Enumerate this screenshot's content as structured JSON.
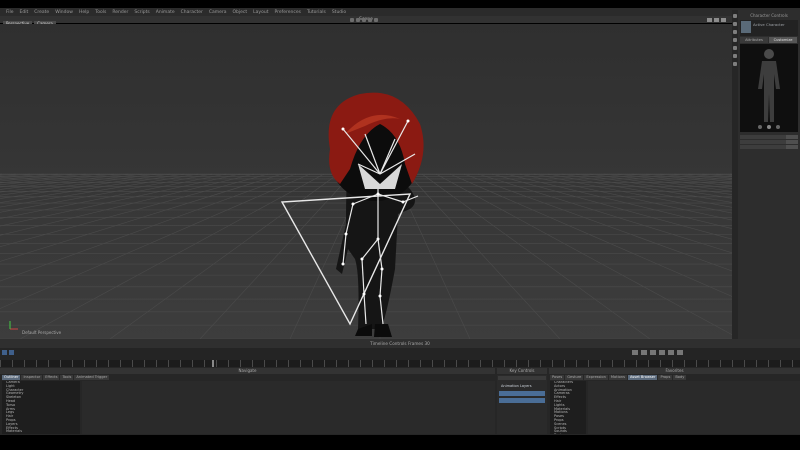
{
  "window": {
    "title": "Scene"
  },
  "menubar": {
    "items": [
      "File",
      "Edit",
      "Create",
      "Window",
      "Help",
      "Tools",
      "Render",
      "Scripts",
      "Animate",
      "Character",
      "Camera",
      "Object",
      "Layout",
      "Preferences",
      "Tutorials",
      "Studio"
    ]
  },
  "viewport": {
    "left_buttons": [
      "Perspective",
      "Camera"
    ],
    "corner_label": "Default Perspective"
  },
  "character_panel": {
    "title": "Character Controls",
    "name": "Active Character",
    "tabs": [
      "Attributes",
      "Customize"
    ],
    "active_tab": 1
  },
  "timeline": {
    "header": "Timeline Controls   Frames  30",
    "scene_label": "Scene"
  },
  "bottom": {
    "outliner_head": "Navigate",
    "outliner_tabs": [
      "Outliner",
      "Inspector",
      "Effects",
      "Tools",
      "Animated Trigger"
    ],
    "outliner_items": [
      "Camera",
      "Light",
      "Character",
      "Geometry",
      "Skeleton",
      "Head",
      "Torso",
      "Arms",
      "Legs",
      "Hair",
      "Props",
      "Layers",
      "Effects",
      "Materials"
    ],
    "keys_head": "Key Controls",
    "keys_label": "Animation Layers",
    "assets_head": "Favorites",
    "assets_tabs": [
      "Poses",
      "Gesture",
      "Expression",
      "Motions",
      "Asset Browser",
      "Props",
      "Body"
    ],
    "asset_items": [
      "Characters",
      "Actors",
      "Animation",
      "Cameras",
      "Effects",
      "Hair",
      "Lights",
      "Materials",
      "Motions",
      "Poses",
      "Props",
      "Scenes",
      "Scripts",
      "Sounds",
      "Textures",
      "Tools",
      "Templates"
    ]
  },
  "colors": {
    "viewport_bg": "#3a3a3a",
    "hair": "#8b1a12",
    "bone": "#e8e8e8",
    "accent": "#5b6a7c"
  }
}
